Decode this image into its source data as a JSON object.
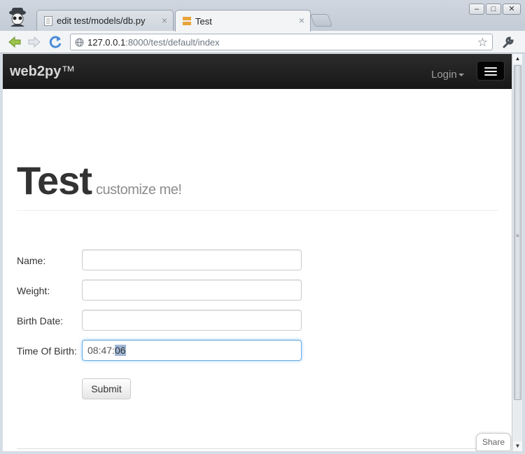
{
  "browser": {
    "tabs": [
      {
        "label": "edit test/models/db.py",
        "active": false
      },
      {
        "label": "Test",
        "active": true
      }
    ],
    "close_glyph": "×",
    "url_host": "127.0.0.1",
    "url_path": ":8000/test/default/index",
    "window_buttons": {
      "minimize": "–",
      "maximize": "□",
      "close": "✕"
    }
  },
  "navbar": {
    "brand": "web2py",
    "brand_tm": "™",
    "login_label": "Login"
  },
  "header": {
    "title": "Test",
    "subtitle": "customize me!"
  },
  "form": {
    "fields": [
      {
        "label": "Name:",
        "value": ""
      },
      {
        "label": "Weight:",
        "value": ""
      },
      {
        "label": "Birth Date:",
        "value": ""
      },
      {
        "label": "Time Of Birth:",
        "value_unselected": "08:47:",
        "value_selected": "06"
      }
    ],
    "submit_label": "Submit"
  },
  "share_label": "Share",
  "colors": {
    "navbar_bg": "#1b1b1b",
    "focus_border": "#66afe9",
    "title": "#333333",
    "subtitle": "#8d8d8d"
  }
}
